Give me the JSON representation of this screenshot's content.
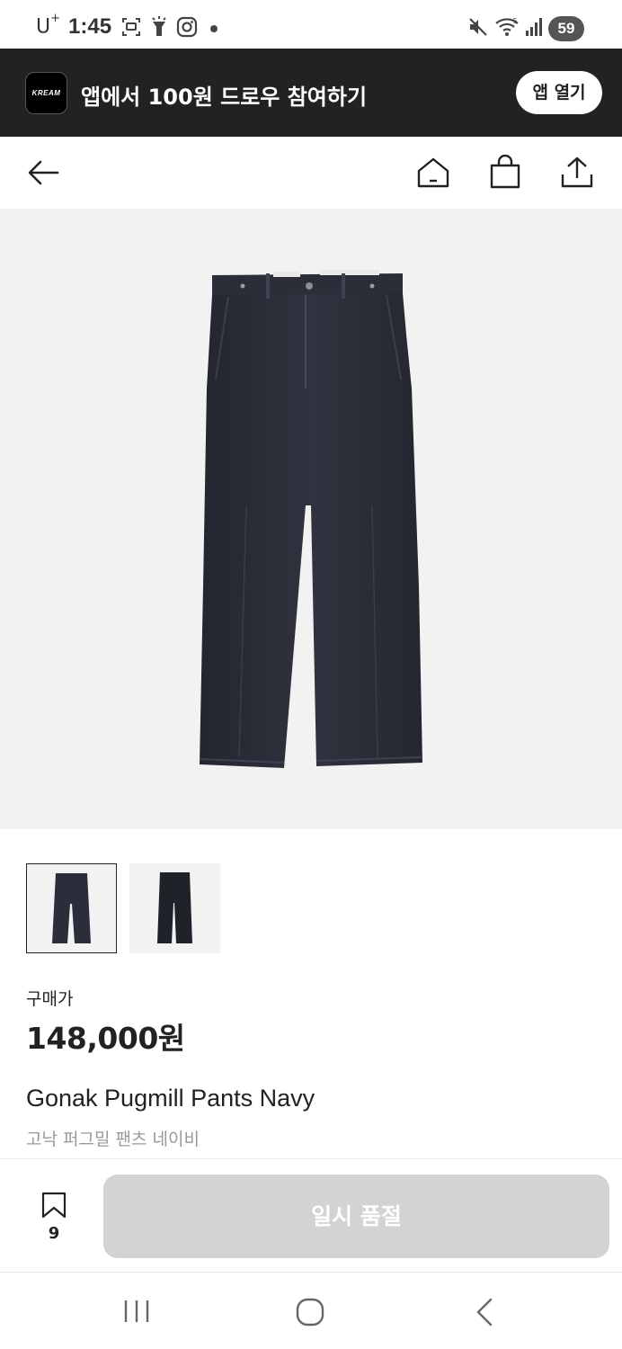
{
  "status_bar": {
    "carrier": "U",
    "carrier_sup": "+",
    "time": "1:45",
    "battery": "59",
    "icons": [
      "screenshot-icon",
      "flashlight-icon",
      "instagram-icon",
      "dot-icon",
      "mute-icon",
      "wifi-icon",
      "signal-icon"
    ]
  },
  "app_banner": {
    "logo_text": "KREAM",
    "text": "앱에서 100원 드로우 참여하기",
    "open_button": "앱 열기"
  },
  "nav": {
    "icons": [
      "back-arrow-icon",
      "home-icon",
      "shopping-bag-icon",
      "share-icon"
    ]
  },
  "product": {
    "price_label": "구매가",
    "price": "148,000원",
    "name_en": "Gonak Pugmill Pants Navy",
    "name_ko": "고낙 퍼그밀 팬츠 네이비",
    "thumbnails_count": 2,
    "selected_thumbnail": 1
  },
  "action_bar": {
    "bookmark_count": "9",
    "soldout_label": "일시 품절"
  },
  "colors": {
    "banner_bg": "#222222",
    "hero_bg": "#f2f2f2",
    "soldout_bg": "#d3d3d3",
    "pants": "#2a2d3a"
  }
}
